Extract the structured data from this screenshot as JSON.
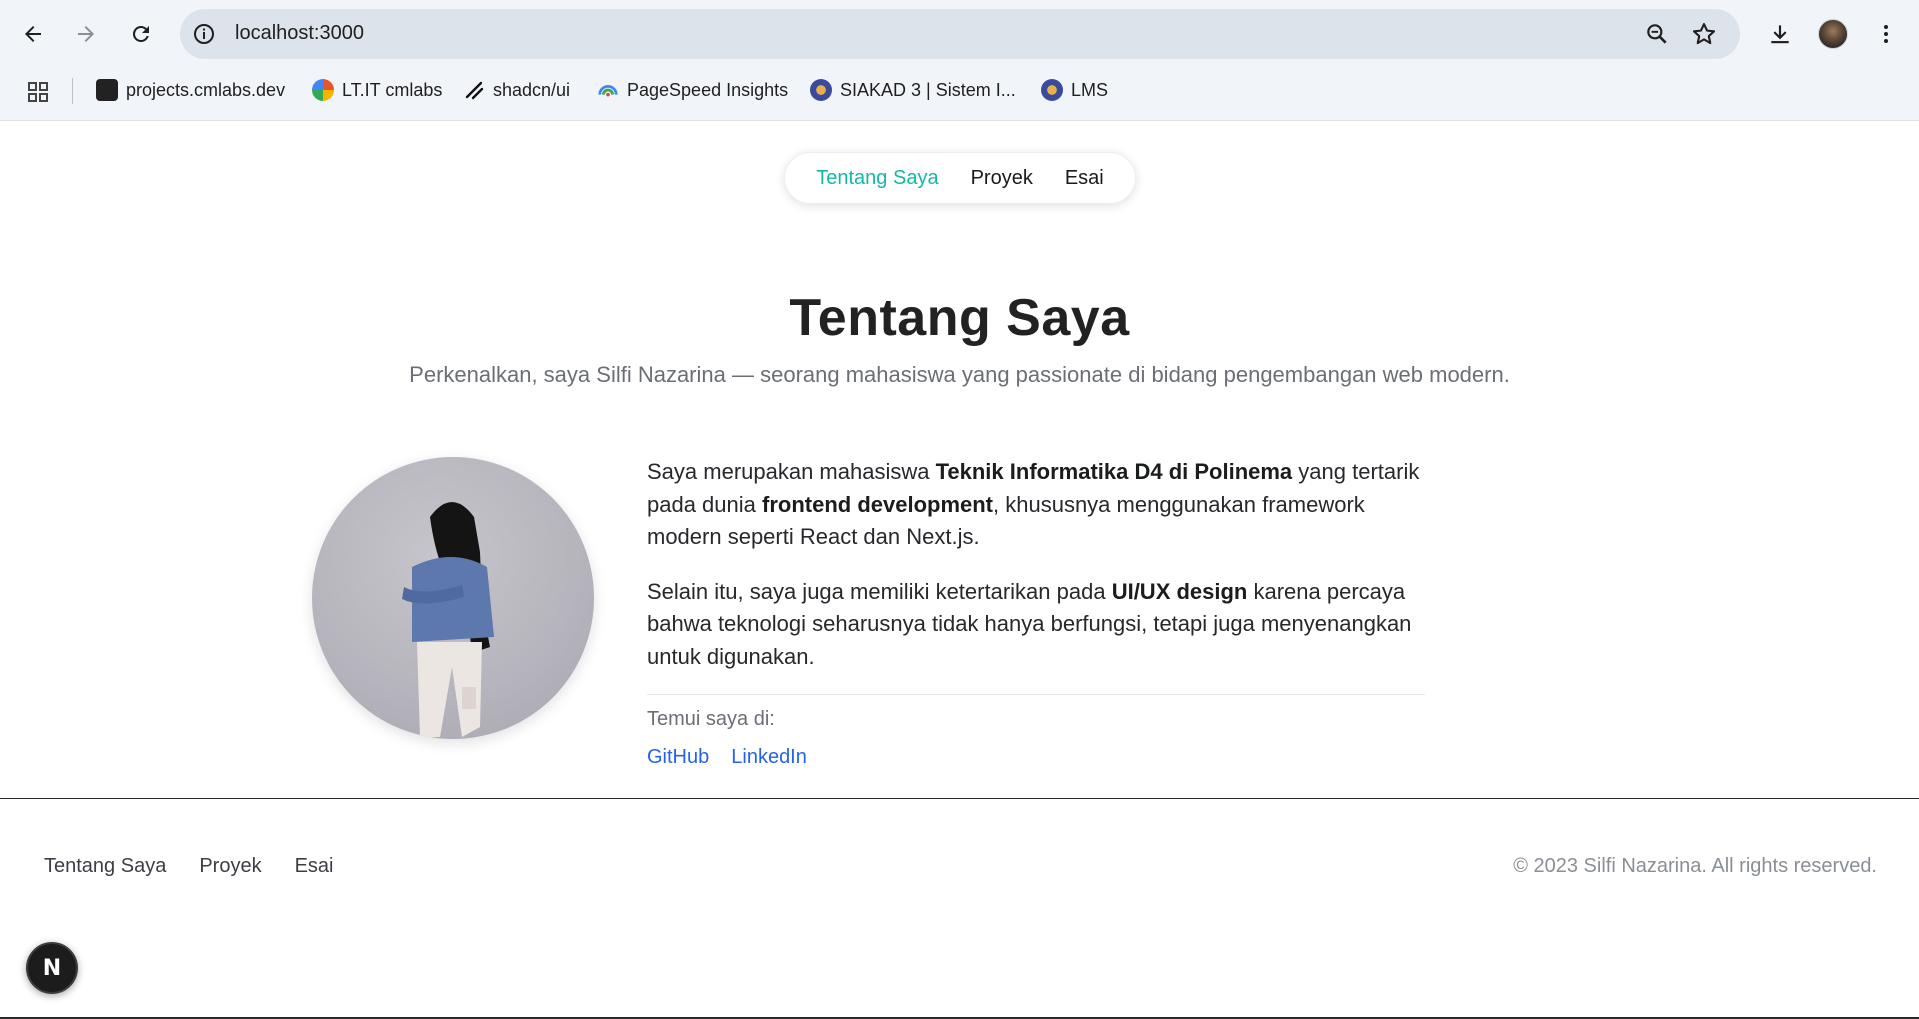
{
  "browser": {
    "url": "localhost:3000",
    "bookmarks": [
      {
        "label": "projects.cmlabs.dev",
        "icon": "cmlabs-favicon-icon",
        "color": "#222222"
      },
      {
        "label": "LT.IT cmlabs",
        "icon": "lt-it-favicon-icon",
        "color": "#e8552d"
      },
      {
        "label": "shadcn/ui",
        "icon": "shadcn-favicon-icon",
        "color": "#111111"
      },
      {
        "label": "PageSpeed Insights",
        "icon": "pagespeed-favicon-icon",
        "color": "#4285f4"
      },
      {
        "label": "SIAKAD 3 | Sistem I...",
        "icon": "polinema-favicon-icon",
        "color": "#3b4a9a"
      },
      {
        "label": "LMS",
        "icon": "polinema-favicon-icon",
        "color": "#3b4a9a"
      }
    ]
  },
  "nav": {
    "items": [
      {
        "label": "Tentang Saya",
        "active": true
      },
      {
        "label": "Proyek",
        "active": false
      },
      {
        "label": "Esai",
        "active": false
      }
    ]
  },
  "hero": {
    "title": "Tentang Saya",
    "subtitle": "Perkenalkan, saya Silfi Nazarina — seorang mahasiswa yang passionate di bidang pengembangan web modern."
  },
  "bio": {
    "p1_a": "Saya merupakan mahasiswa ",
    "p1_b": "Teknik Informatika D4 di Polinema",
    "p1_c": " yang tertarik pada dunia ",
    "p1_d": "frontend development",
    "p1_e": ", khususnya menggunakan framework modern seperti React dan Next.js.",
    "p2_a": "Selain itu, saya juga memiliki ketertarikan pada ",
    "p2_b": "UI/UX design",
    "p2_c": " karena percaya bahwa teknologi seharusnya tidak hanya berfungsi, tetapi juga menyenangkan untuk digunakan.",
    "meet_label": "Temui saya di:",
    "links": {
      "github": "GitHub",
      "linkedin": "LinkedIn"
    }
  },
  "footer": {
    "nav": {
      "about": "Tentang Saya",
      "projects": "Proyek",
      "essays": "Esai"
    },
    "copyright": "© 2023 Silfi Nazarina. All rights reserved."
  },
  "dev_badge": {
    "letter": "N"
  },
  "colors": {
    "accent": "#14b8a6",
    "link": "#2563eb",
    "muted": "#6b6f75"
  }
}
